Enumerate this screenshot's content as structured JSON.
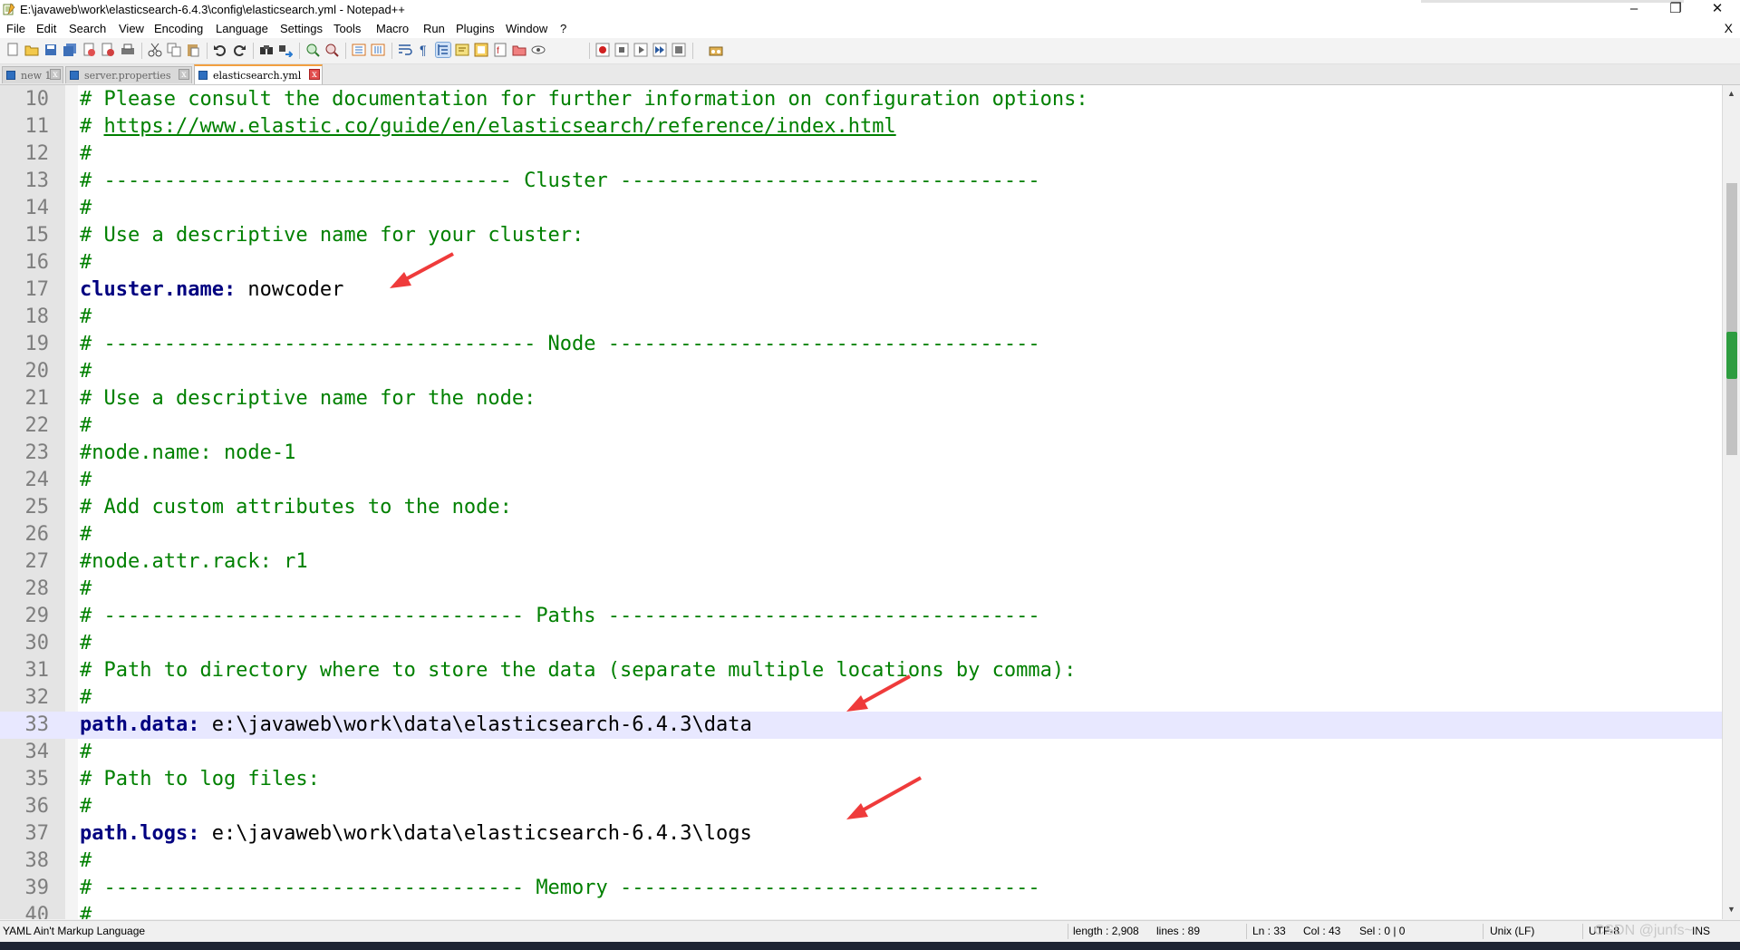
{
  "window": {
    "title": "E:\\javaweb\\work\\elasticsearch-6.4.3\\config\\elasticsearch.yml - Notepad++",
    "controls": {
      "minimize": "–",
      "maximize": "❐",
      "close": "✕"
    }
  },
  "menu": {
    "items": [
      "File",
      "Edit",
      "Search",
      "View",
      "Encoding",
      "Language",
      "Settings",
      "Tools",
      "Macro",
      "Run",
      "Plugins",
      "Window",
      "?"
    ],
    "close_doc": "X"
  },
  "toolbar": {
    "icons": [
      "new-file-icon",
      "open-file-icon",
      "save-icon",
      "save-all-icon",
      "close-icon",
      "close-all-icon",
      "print-icon",
      "cut-icon",
      "copy-icon",
      "paste-icon",
      "undo-icon",
      "redo-icon",
      "find-icon",
      "replace-icon",
      "zoom-in-icon",
      "zoom-out-icon",
      "sync-vertical-icon",
      "sync-horizontal-icon",
      "word-wrap-icon",
      "show-all-chars-icon",
      "indent-guide-icon",
      "user-language-icon",
      "document-map-icon",
      "function-list-icon",
      "folder-workspace-icon",
      "monitoring-icon",
      "record-macro-icon",
      "stop-macro-icon",
      "play-macro-icon",
      "run-macro-multiple-icon",
      "save-macro-icon",
      "spell-check-icon"
    ]
  },
  "tabs": [
    {
      "label": "new 1",
      "active": false
    },
    {
      "label": "server.properties",
      "active": false
    },
    {
      "label": "elasticsearch.yml",
      "active": true
    }
  ],
  "tab_close": "x",
  "editor": {
    "lines": [
      {
        "n": "10",
        "segments": [
          {
            "t": "# Please consult the documentation for further information on configuration options:",
            "c": "cmt"
          }
        ]
      },
      {
        "n": "11",
        "segments": [
          {
            "t": "# ",
            "c": "cmt"
          },
          {
            "t": "https://www.elastic.co/guide/en/elasticsearch/reference/index.html",
            "c": "link"
          }
        ]
      },
      {
        "n": "12",
        "segments": [
          {
            "t": "#",
            "c": "cmt"
          }
        ]
      },
      {
        "n": "13",
        "segments": [
          {
            "t": "# ---------------------------------- Cluster -----------------------------------",
            "c": "cmt"
          }
        ]
      },
      {
        "n": "14",
        "segments": [
          {
            "t": "#",
            "c": "cmt"
          }
        ]
      },
      {
        "n": "15",
        "segments": [
          {
            "t": "# Use a descriptive name for your cluster:",
            "c": "cmt"
          }
        ]
      },
      {
        "n": "16",
        "segments": [
          {
            "t": "#",
            "c": "cmt"
          }
        ]
      },
      {
        "n": "17",
        "segments": [
          {
            "t": "cluster.name:",
            "c": "key"
          },
          {
            "t": " nowcoder",
            "c": "val"
          }
        ]
      },
      {
        "n": "18",
        "segments": [
          {
            "t": "#",
            "c": "cmt"
          }
        ]
      },
      {
        "n": "19",
        "segments": [
          {
            "t": "# ------------------------------------ Node ------------------------------------",
            "c": "cmt"
          }
        ]
      },
      {
        "n": "20",
        "segments": [
          {
            "t": "#",
            "c": "cmt"
          }
        ]
      },
      {
        "n": "21",
        "segments": [
          {
            "t": "# Use a descriptive name for the node:",
            "c": "cmt"
          }
        ]
      },
      {
        "n": "22",
        "segments": [
          {
            "t": "#",
            "c": "cmt"
          }
        ]
      },
      {
        "n": "23",
        "segments": [
          {
            "t": "#node.name: node-1",
            "c": "cmt"
          }
        ]
      },
      {
        "n": "24",
        "segments": [
          {
            "t": "#",
            "c": "cmt"
          }
        ]
      },
      {
        "n": "25",
        "segments": [
          {
            "t": "# Add custom attributes to the node:",
            "c": "cmt"
          }
        ]
      },
      {
        "n": "26",
        "segments": [
          {
            "t": "#",
            "c": "cmt"
          }
        ]
      },
      {
        "n": "27",
        "segments": [
          {
            "t": "#node.attr.rack: r1",
            "c": "cmt"
          }
        ]
      },
      {
        "n": "28",
        "segments": [
          {
            "t": "#",
            "c": "cmt"
          }
        ]
      },
      {
        "n": "29",
        "segments": [
          {
            "t": "# ----------------------------------- Paths ------------------------------------",
            "c": "cmt"
          }
        ]
      },
      {
        "n": "30",
        "segments": [
          {
            "t": "#",
            "c": "cmt"
          }
        ]
      },
      {
        "n": "31",
        "segments": [
          {
            "t": "# Path to directory where to store the data (separate multiple locations by comma):",
            "c": "cmt"
          }
        ]
      },
      {
        "n": "32",
        "segments": [
          {
            "t": "#",
            "c": "cmt"
          }
        ]
      },
      {
        "n": "33",
        "current": true,
        "segments": [
          {
            "t": "path.data:",
            "c": "key"
          },
          {
            "t": " e:\\javaweb\\work\\data\\elasticsearch-6.4.3\\data",
            "c": "val"
          }
        ]
      },
      {
        "n": "34",
        "segments": [
          {
            "t": "#",
            "c": "cmt"
          }
        ]
      },
      {
        "n": "35",
        "segments": [
          {
            "t": "# Path to log files:",
            "c": "cmt"
          }
        ]
      },
      {
        "n": "36",
        "segments": [
          {
            "t": "#",
            "c": "cmt"
          }
        ]
      },
      {
        "n": "37",
        "segments": [
          {
            "t": "path.logs:",
            "c": "key"
          },
          {
            "t": " e:\\javaweb\\work\\data\\elasticsearch-6.4.3\\logs",
            "c": "val"
          }
        ]
      },
      {
        "n": "38",
        "segments": [
          {
            "t": "#",
            "c": "cmt"
          }
        ]
      },
      {
        "n": "39",
        "segments": [
          {
            "t": "# ----------------------------------- Memory -----------------------------------",
            "c": "cmt"
          }
        ]
      },
      {
        "n": "40",
        "segments": [
          {
            "t": "#",
            "c": "cmt"
          }
        ]
      }
    ]
  },
  "status": {
    "language": "YAML Ain't Markup Language",
    "length": "length : 2,908",
    "lines": "lines : 89",
    "ln": "Ln : 33",
    "col": "Col : 43",
    "sel": "Sel : 0 | 0",
    "eol": "Unix (LF)",
    "encoding": "UTF-8",
    "ins": "INS"
  },
  "watermark": "CSDN @junfs~",
  "colors": {
    "comment": "#008000",
    "key": "#000080",
    "arrow": "#ef3b3b",
    "current_line": "#e8e8ff"
  }
}
